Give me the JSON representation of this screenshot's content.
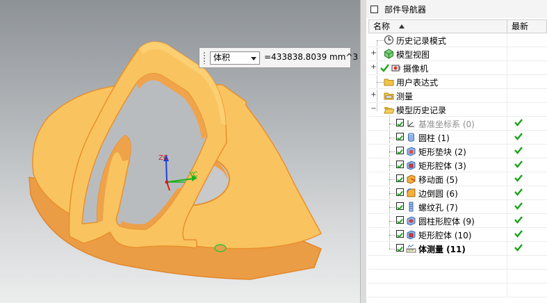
{
  "measure": {
    "type_label": "体积",
    "value": "=433838.8039 mm^3"
  },
  "navigator": {
    "title": "部件导航器",
    "columns": {
      "name": "名称",
      "latest": "最新"
    },
    "items": [
      {
        "label": "历史记录模式",
        "icon": "clock-icon"
      },
      {
        "label": "模型视图",
        "icon": "model-views-icon"
      },
      {
        "label": "摄像机",
        "icon": "camera-icon"
      },
      {
        "label": "用户表达式",
        "icon": "folder-icon"
      },
      {
        "label": "测量",
        "icon": "measure-folder-icon"
      },
      {
        "label": "模型历史记录",
        "icon": "open-folder-icon"
      }
    ],
    "features": [
      {
        "label": "基准坐标系 (0)",
        "icon": "datum-csys-icon",
        "checked": true,
        "latest": true,
        "muted": true
      },
      {
        "label": "圆柱 (1)",
        "icon": "cylinder-icon",
        "checked": true,
        "latest": true
      },
      {
        "label": "矩形垫块 (2)",
        "icon": "pad-icon",
        "checked": true,
        "latest": true
      },
      {
        "label": "矩形腔体 (3)",
        "icon": "pocket-icon",
        "checked": true,
        "latest": true
      },
      {
        "label": "移动面 (5)",
        "icon": "move-face-icon",
        "checked": true,
        "latest": true
      },
      {
        "label": "边倒圆 (6)",
        "icon": "edge-blend-icon",
        "checked": true,
        "latest": true
      },
      {
        "label": "螺纹孔 (7)",
        "icon": "threaded-hole-icon",
        "checked": true,
        "latest": true
      },
      {
        "label": "圆柱形腔体 (9)",
        "icon": "cylindrical-pocket-icon",
        "checked": true,
        "latest": true
      },
      {
        "label": "矩形腔体 (10)",
        "icon": "pocket-icon",
        "checked": true,
        "latest": true
      },
      {
        "label": "体测量 (11)",
        "icon": "body-measure-icon",
        "checked": true,
        "latest": true,
        "bold": true
      }
    ]
  },
  "axes": {
    "z": "ZC",
    "y": "YC"
  },
  "colors": {
    "part": "#f8c25c",
    "part_edge": "#e98f2c",
    "check": "#16a316"
  }
}
